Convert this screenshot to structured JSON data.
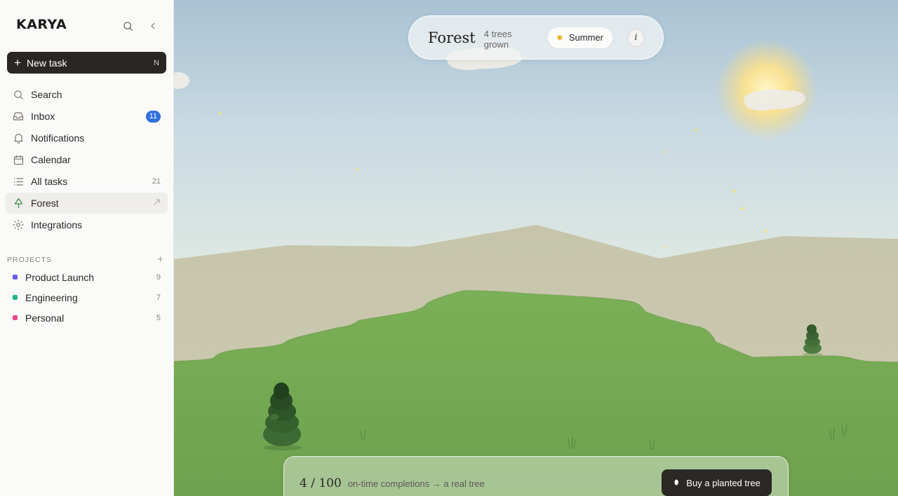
{
  "app": {
    "brand": "KARYA"
  },
  "sidebar": {
    "new_task": {
      "label": "New task",
      "shortcut": "N"
    },
    "nav": [
      {
        "label": "Search",
        "icon": "search-icon"
      },
      {
        "label": "Inbox",
        "icon": "inbox-icon",
        "badge": "11"
      },
      {
        "label": "Notifications",
        "icon": "bell-icon"
      },
      {
        "label": "Calendar",
        "icon": "calendar-icon"
      },
      {
        "label": "All tasks",
        "icon": "list-icon",
        "count": "21"
      },
      {
        "label": "Forest",
        "icon": "tree-icon",
        "active": true
      },
      {
        "label": "Integrations",
        "icon": "integrations-icon"
      }
    ],
    "projects_heading": "PROJECTS",
    "projects": [
      {
        "label": "Product Launch",
        "count": "9",
        "color": "#6b5ce7"
      },
      {
        "label": "Engineering",
        "count": "7",
        "color": "#1fb586"
      },
      {
        "label": "Personal",
        "count": "5",
        "color": "#e84a8a"
      }
    ]
  },
  "forest": {
    "title": "Forest",
    "subtitle": "4 trees grown",
    "season": "Summer",
    "info_label": "i",
    "progress": {
      "completed": 4,
      "target": 100,
      "label": "4 / 100",
      "description": "on-time completions → a real tree"
    },
    "buy_button": "Buy a planted tree"
  },
  "colors": {
    "accent": "#2f6fde",
    "sidebar_bg": "#fafaf9",
    "button_dark": "#2a2624",
    "grass": "#7aad55",
    "mountain": "#c9c8ae",
    "sun": "#fbe089"
  }
}
